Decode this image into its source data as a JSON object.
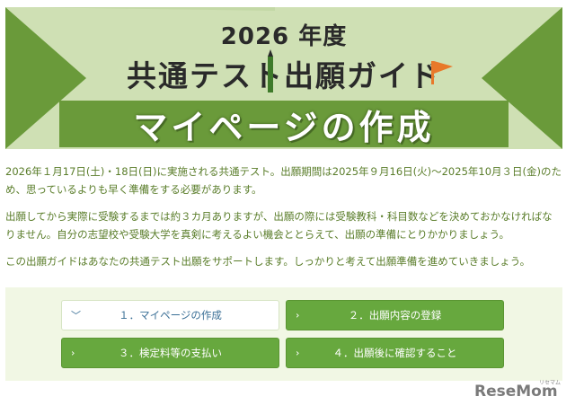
{
  "banner": {
    "year": "2026 年度",
    "guide_title": "共通テスト出願ガイド",
    "subtitle": "マイページの作成"
  },
  "intro": {
    "paragraphs": [
      "2026年１月17日(土)・18日(日)に実施される共通テスト。出願期間は2025年９月16日(火)〜2025年10月３日(金)のため、思っているよりも早く準備をする必要があります。",
      "出願してから実際に受験するまでは約３カ月ありますが、出願の際には受験教科・科目数などを決めておかなければなりません。自分の志望校や受験大学を真剣に考えるよい機会ととらえて、出願の準備にとりかかりましょう。",
      "この出願ガイドはあなたの共通テスト出願をサポートします。しっかりと考えて出願準備を進めていきましょう。"
    ]
  },
  "nav": {
    "items": [
      {
        "label": "１．マイページの作成",
        "active": true
      },
      {
        "label": "２．出願内容の登録",
        "active": false
      },
      {
        "label": "３．検定料等の支払い",
        "active": false
      },
      {
        "label": "４．出願後に確認すること",
        "active": false
      }
    ]
  },
  "logo": {
    "text": "ReseMom",
    "sub": "リセマム"
  },
  "colors": {
    "banner_bg": "#cfe0b4",
    "banner_triangle": "#6a9a3a",
    "text_green": "#5a7d2a",
    "button_green": "#67a83e",
    "active_text": "#3a6f96"
  }
}
